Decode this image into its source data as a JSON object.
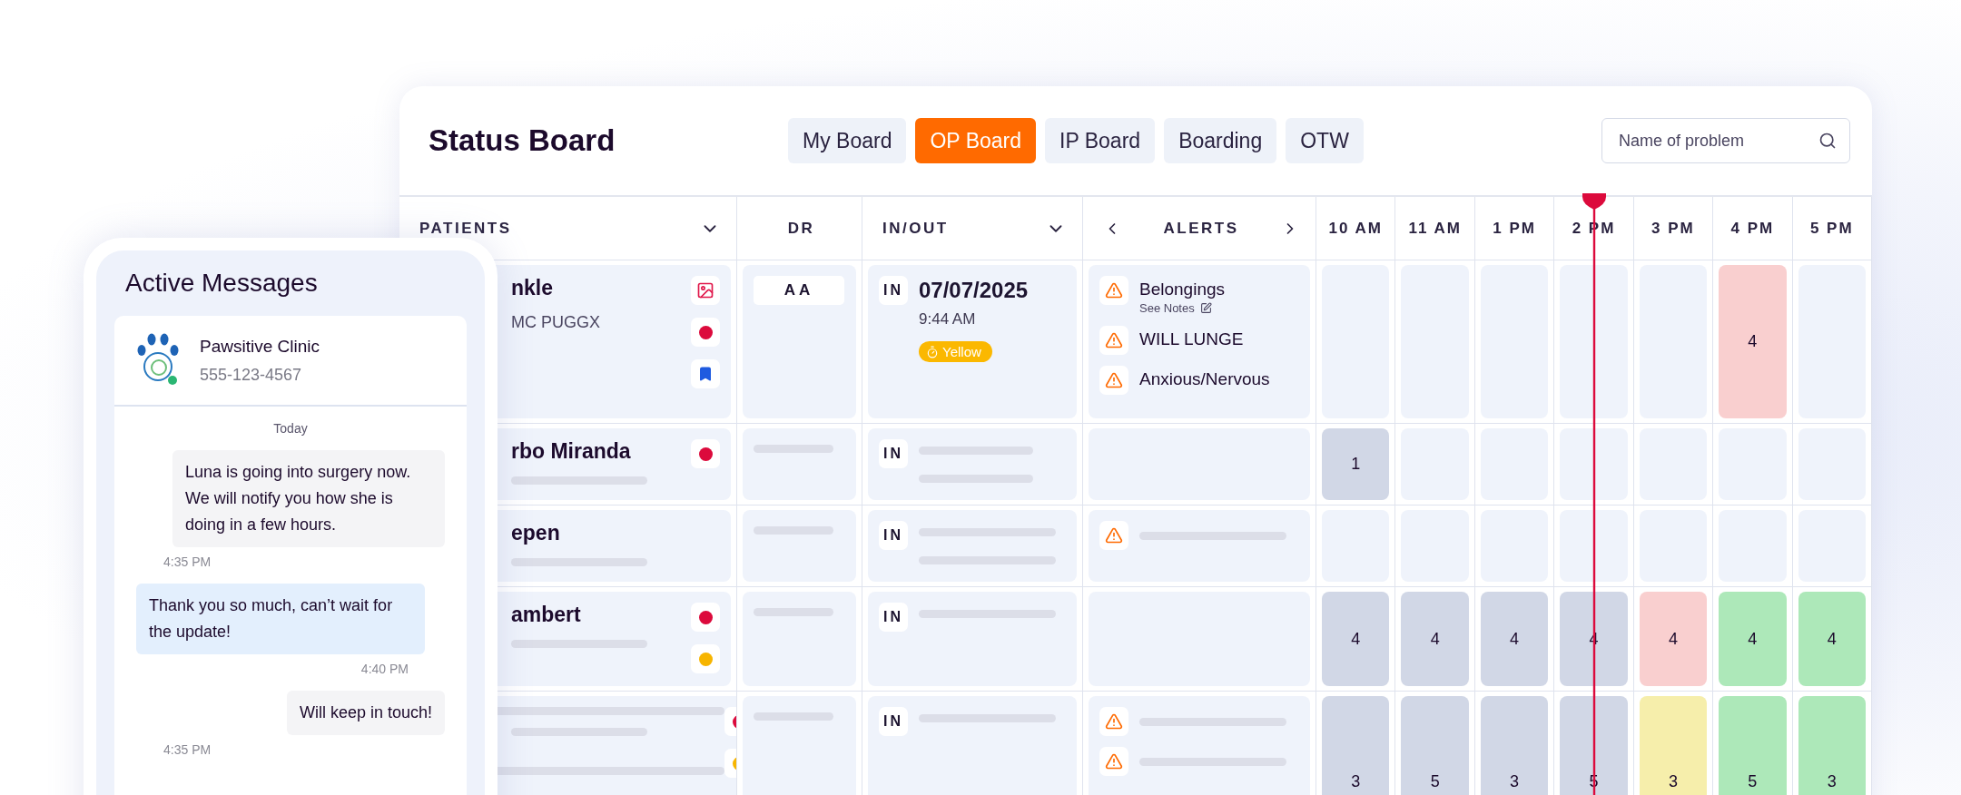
{
  "board": {
    "title": "Status Board",
    "tabs": [
      {
        "label": "My Board",
        "selected": false
      },
      {
        "label": "OP Board",
        "selected": true
      },
      {
        "label": "IP Board",
        "selected": false
      },
      {
        "label": "Boarding",
        "selected": false
      },
      {
        "label": "OTW",
        "selected": false
      }
    ],
    "search": {
      "placeholder": "Name of problem"
    },
    "columns": {
      "patients": "PATIENTS",
      "dr": "DR",
      "in_out": "IN/OUT",
      "alerts": "ALERTS",
      "times": [
        "10 AM",
        "11 AM",
        "1 PM",
        "2 PM",
        "3 PM",
        "4 PM",
        "5 PM"
      ]
    },
    "rows": [
      {
        "patient": {
          "name": "nkle",
          "subtitle": "MC PUGGX",
          "flags": [
            {
              "kind": "image"
            },
            {
              "kind": "dot",
              "color": "#dc0a3c"
            },
            {
              "kind": "bookmark"
            }
          ]
        },
        "dr": "AA",
        "in_out": {
          "status": "IN",
          "date": "07/07/2025",
          "time": "9:44 AM",
          "badge": "Yellow"
        },
        "alerts": [
          {
            "kind": "text",
            "label": "Belongings",
            "note": "See Notes"
          },
          {
            "kind": "text",
            "label": "WILL LUNGE"
          },
          {
            "kind": "text",
            "label": "Anxious/Nervous"
          }
        ],
        "slots": [
          {
            "kind": "empty"
          },
          {
            "kind": "empty"
          },
          {
            "kind": "empty"
          },
          {
            "kind": "empty"
          },
          {
            "kind": "empty"
          },
          {
            "kind": "filled",
            "value": "4",
            "color": "#f9cfcf"
          },
          {
            "kind": "empty"
          }
        ]
      },
      {
        "patient": {
          "name": "rbo Miranda",
          "flags": [
            {
              "kind": "dot",
              "color": "#dc0a3c"
            }
          ]
        },
        "in_out": {
          "status": "IN"
        },
        "alerts": [],
        "slots": [
          {
            "kind": "filled",
            "value": "1",
            "color": "#d1d7e6"
          },
          {
            "kind": "empty"
          },
          {
            "kind": "empty"
          },
          {
            "kind": "empty"
          },
          {
            "kind": "empty"
          },
          {
            "kind": "empty"
          },
          {
            "kind": "empty"
          }
        ]
      },
      {
        "patient": {
          "name": "epen"
        },
        "in_out": {
          "status": "IN"
        },
        "alerts": [
          {
            "kind": "placeholder"
          }
        ],
        "slots": [
          {
            "kind": "empty"
          },
          {
            "kind": "empty"
          },
          {
            "kind": "empty"
          },
          {
            "kind": "empty"
          },
          {
            "kind": "empty"
          },
          {
            "kind": "empty"
          },
          {
            "kind": "empty"
          }
        ]
      },
      {
        "patient": {
          "name": "ambert",
          "flags": [
            {
              "kind": "dot",
              "color": "#dc0a3c"
            },
            {
              "kind": "dot",
              "color": "#f7b500"
            }
          ]
        },
        "in_out": {
          "status": "IN"
        },
        "alerts": [],
        "slots": [
          {
            "kind": "filled",
            "value": "4",
            "color": "#d1d7e6"
          },
          {
            "kind": "filled",
            "value": "4",
            "color": "#d1d7e6"
          },
          {
            "kind": "filled",
            "value": "4",
            "color": "#d1d7e6"
          },
          {
            "kind": "filled",
            "value": "4",
            "color": "#d1d7e6"
          },
          {
            "kind": "filled",
            "value": "4",
            "color": "#f9cfcf"
          },
          {
            "kind": "filled",
            "value": "4",
            "color": "#ade8b9"
          },
          {
            "kind": "filled",
            "value": "4",
            "color": "#ade8b9"
          }
        ]
      },
      {
        "patient": {
          "flags": [
            {
              "kind": "dot",
              "color": "#dc0a3c"
            },
            {
              "kind": "dot",
              "color": "#f7b500"
            }
          ]
        },
        "in_out": {
          "status": "IN"
        },
        "alerts": [
          {
            "kind": "placeholder"
          },
          {
            "kind": "placeholder"
          }
        ],
        "slots": [
          {
            "kind": "filled",
            "value": "3",
            "color": "#d1d7e6"
          },
          {
            "kind": "filled",
            "value": "5",
            "color": "#d1d7e6"
          },
          {
            "kind": "filled",
            "value": "3",
            "color": "#d1d7e6"
          },
          {
            "kind": "filled",
            "value": "5",
            "color": "#d1d7e6"
          },
          {
            "kind": "filled",
            "value": "3",
            "color": "#f6eeab"
          },
          {
            "kind": "filled",
            "value": "5",
            "color": "#ade8b9"
          },
          {
            "kind": "filled",
            "value": "3",
            "color": "#ade8b9"
          }
        ]
      }
    ]
  },
  "messages": {
    "title": "Active Messages",
    "contact": {
      "name": "Pawsitive Clinic",
      "phone": "555-123-4567"
    },
    "day": "Today",
    "items": [
      {
        "kind": "clinic",
        "text": "Luna is going into surgery now. We will notify you how she is doing in a few hours.",
        "time": "4:35 PM"
      },
      {
        "kind": "owner",
        "text": "Thank you so much, can’t wait for the update!",
        "time": "4:40 PM"
      },
      {
        "kind": "clinic",
        "text": "Will keep in touch!",
        "time": "4:35 PM"
      }
    ]
  }
}
